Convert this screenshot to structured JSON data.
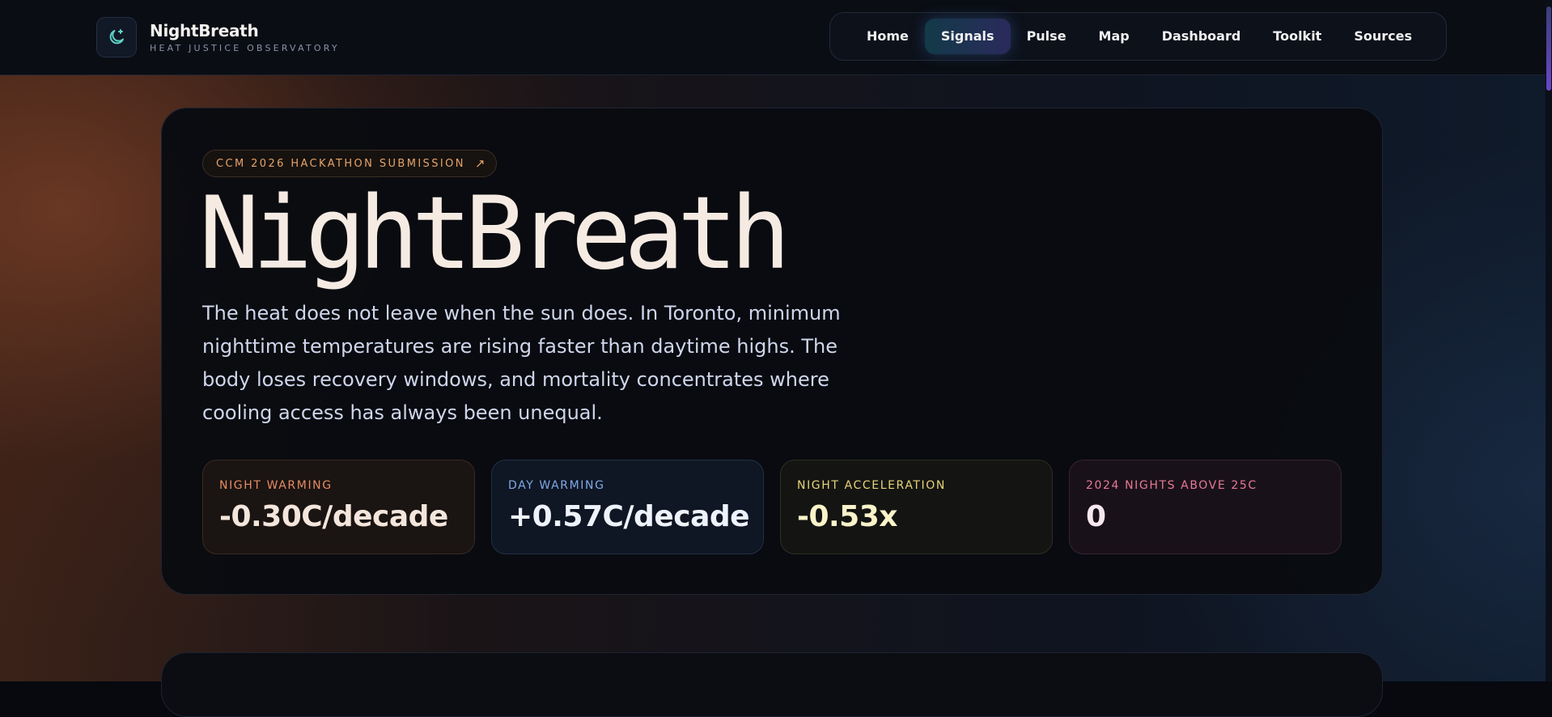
{
  "brand": {
    "name": "NightBreath",
    "subtitle": "HEAT JUSTICE OBSERVATORY",
    "icon": "moon-sparkle-icon"
  },
  "nav": {
    "items": [
      {
        "label": "Home",
        "active": false
      },
      {
        "label": "Signals",
        "active": true
      },
      {
        "label": "Pulse",
        "active": false
      },
      {
        "label": "Map",
        "active": false
      },
      {
        "label": "Dashboard",
        "active": false
      },
      {
        "label": "Toolkit",
        "active": false
      },
      {
        "label": "Sources",
        "active": false
      }
    ]
  },
  "hero": {
    "badge": "CCM 2026 HACKATHON SUBMISSION",
    "badge_icon": "arrow-up-right-icon",
    "title": "NightBreath",
    "description": "The heat does not leave when the sun does. In Toronto, minimum nighttime temperatures are rising faster than daytime highs. The body loses recovery windows, and mortality concentrates where cooling access has always been unequal."
  },
  "stats": [
    {
      "label": "NIGHT WARMING",
      "value": "-0.30C/decade",
      "color": "#e68b63"
    },
    {
      "label": "DAY WARMING",
      "value": "+0.57C/decade",
      "color": "#7fa9e6"
    },
    {
      "label": "NIGHT ACCELERATION",
      "value": "-0.53x",
      "color": "#e8d37a"
    },
    {
      "label": "2024 NIGHTS ABOVE 25C",
      "value": "0",
      "color": "#e77a93"
    }
  ]
}
